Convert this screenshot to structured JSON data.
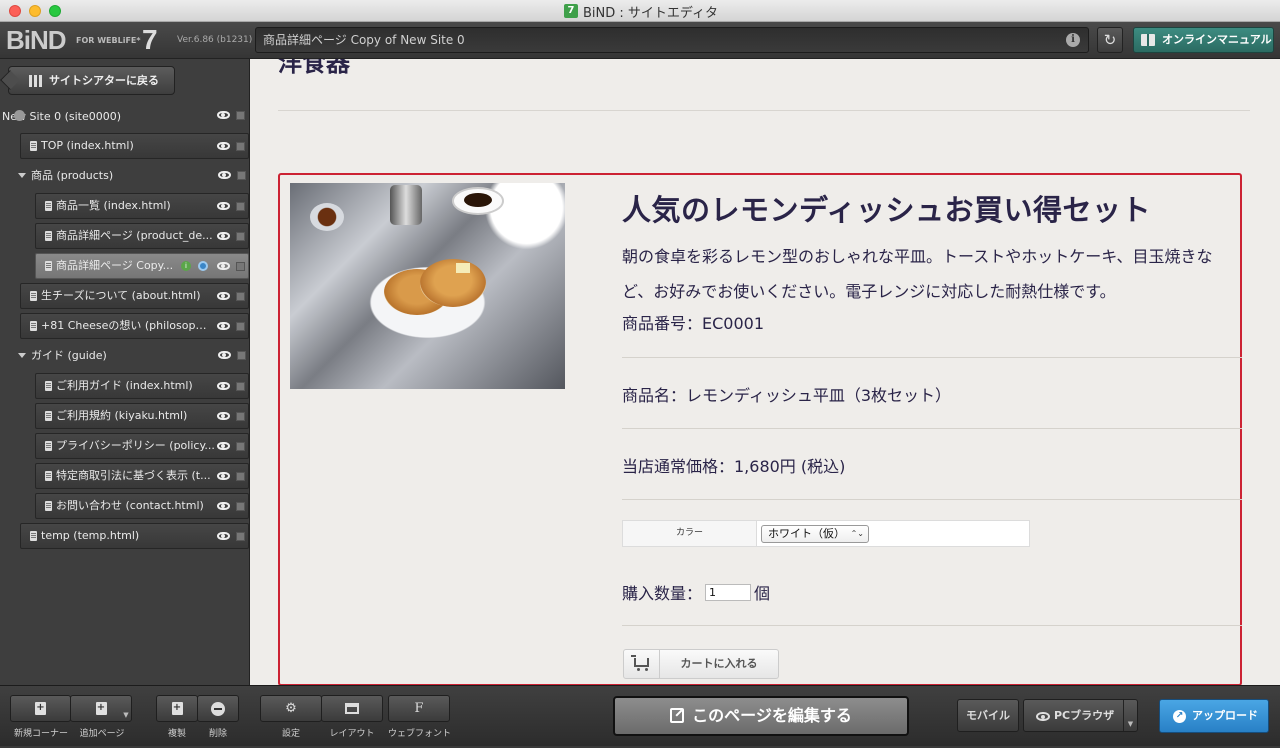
{
  "window": {
    "title": "BiND : サイトエディタ",
    "app_icon_text": "7"
  },
  "toolbar": {
    "logo": "BiND",
    "logo_sub": "FOR WEBLiFE*",
    "logo_version_num": "7",
    "version": "Ver.6.86 (b1231)",
    "path": "商品詳細ページ Copy of New Site 0",
    "info_icon_text": "i",
    "refresh_icon": "↻",
    "manual_label": "オンラインマニュアル"
  },
  "sidebar": {
    "back_label": "サイトシアターに戻る",
    "site_label": "New Site 0 (site0000)",
    "items": [
      {
        "label": "TOP (index.html)"
      },
      {
        "label": "商品 (products)"
      },
      {
        "label": "商品一覧 (index.html)"
      },
      {
        "label": "商品詳細ページ (product_de..."
      },
      {
        "label": "商品詳細ページ Copy..."
      },
      {
        "label": "生チーズについて (about.html)"
      },
      {
        "label": "+81 Cheeseの想い (philosoph..."
      },
      {
        "label": "ガイド (guide)"
      },
      {
        "label": "ご利用ガイド (index.html)"
      },
      {
        "label": "ご利用規約 (kiyaku.html)"
      },
      {
        "label": "プライバシーポリシー (policy..."
      },
      {
        "label": "特定商取引法に基づく表示 (t..."
      },
      {
        "label": "お問い合わせ (contact.html)"
      },
      {
        "label": "temp (temp.html)"
      }
    ]
  },
  "content": {
    "heading_top": "洋食器",
    "product": {
      "title": "人気のレモンディッシュお買い得セット",
      "description": "朝の食卓を彩るレモン型のおしゃれな平皿。トーストやホットケーキ、目玉焼きなど、お好みでお使いください。電子レンジに対応した耐熱仕様です。",
      "code": "商品番号：EC0001",
      "name": "商品名：レモンディッシュ平皿（3枚セット）",
      "price": "当店通常価格：1,680円 (税込)",
      "option_label": "カラー",
      "option_value": "ホワイト（仮）",
      "select_arrows": "⌃⌄",
      "qty_label": "購入数量：",
      "qty_value": "1",
      "qty_unit": "個",
      "cart_label": "カートに入れる"
    }
  },
  "bottombar": {
    "new_corner_label": "新規コーナー",
    "add_page_label": "追加ページ",
    "duplicate_label": "複製",
    "delete_label": "削除",
    "settings_label": "設定",
    "layout_label": "レイアウト",
    "webfont_label": "ウェブフォント",
    "webfont_icon": "F",
    "settings_icon": "⚙",
    "edit_label": "このページを編集する",
    "mobile_label": "モバイル",
    "pcbrowser_label": "PCブラウザ",
    "upload_label": "アップロード",
    "dropdown_glyph": "▼"
  },
  "colors": {
    "accent_selection": "#cc2233",
    "manual_button": "#2b6b62",
    "upload_button": "#2880c6",
    "text_dark": "#2a2448"
  }
}
